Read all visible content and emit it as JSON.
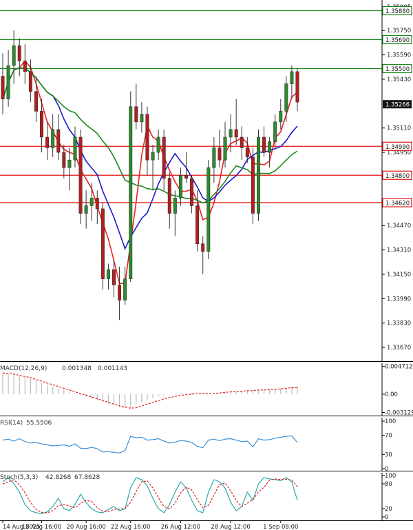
{
  "chart_data": [
    {
      "type": "candlestick",
      "y_ticks": [
        "1.35905",
        "1.35750",
        "1.35590",
        "1.35430",
        "1.35110",
        "1.34950",
        "1.34470",
        "1.34310",
        "1.34150",
        "1.33990",
        "1.33830",
        "1.33670"
      ],
      "y_range": [
        1.3358,
        1.3595
      ],
      "x_ticks": [
        "14 Aug 2025",
        "18 Aug 16:00",
        "20 Aug 16:00",
        "22 Aug 16:00",
        "26 Aug 12:00",
        "28 Aug 12:00",
        "1 Sep 08:00"
      ],
      "current_price": "1.35266",
      "levels": [
        {
          "label": "1.35880",
          "value": 1.3588,
          "color": "#1a8a1a"
        },
        {
          "label": "1.35690",
          "value": 1.3569,
          "color": "#1a8a1a"
        },
        {
          "label": "1.35500",
          "value": 1.355,
          "color": "#1a8a1a"
        },
        {
          "label": "1.34990",
          "value": 1.3499,
          "color": "#e01010"
        },
        {
          "label": "1.34800",
          "value": 1.348,
          "color": "#e01010"
        },
        {
          "label": "1.34620",
          "value": 1.3462,
          "color": "#e01010"
        }
      ],
      "candles": [
        [
          1.3545,
          1.356,
          1.352,
          1.353
        ],
        [
          1.353,
          1.3562,
          1.3525,
          1.3552
        ],
        [
          1.3552,
          1.3575,
          1.354,
          1.3565
        ],
        [
          1.3565,
          1.357,
          1.3545,
          1.3555
        ],
        [
          1.3555,
          1.3566,
          1.354,
          1.3548
        ],
        [
          1.3548,
          1.3556,
          1.3528,
          1.3535
        ],
        [
          1.3535,
          1.3545,
          1.3515,
          1.3522
        ],
        [
          1.3522,
          1.353,
          1.3495,
          1.3505
        ],
        [
          1.3505,
          1.3515,
          1.349,
          1.3498
        ],
        [
          1.3498,
          1.352,
          1.3492,
          1.351
        ],
        [
          1.351,
          1.352,
          1.349,
          1.3495
        ],
        [
          1.3495,
          1.35,
          1.3478,
          1.3485
        ],
        [
          1.3485,
          1.3498,
          1.347,
          1.349
        ],
        [
          1.349,
          1.3512,
          1.3485,
          1.3505
        ],
        [
          1.3505,
          1.351,
          1.3448,
          1.3455
        ],
        [
          1.3455,
          1.347,
          1.3445,
          1.346
        ],
        [
          1.346,
          1.3475,
          1.345,
          1.3465
        ],
        [
          1.3465,
          1.347,
          1.3448,
          1.3458
        ],
        [
          1.3458,
          1.3462,
          1.3405,
          1.3412
        ],
        [
          1.3412,
          1.3422,
          1.3405,
          1.3418
        ],
        [
          1.3418,
          1.3425,
          1.34,
          1.3408
        ],
        [
          1.3408,
          1.342,
          1.3385,
          1.3398
        ],
        [
          1.3398,
          1.342,
          1.3395,
          1.3412
        ],
        [
          1.3412,
          1.3535,
          1.341,
          1.3525
        ],
        [
          1.3525,
          1.354,
          1.351,
          1.3515
        ],
        [
          1.3515,
          1.3528,
          1.3508,
          1.352
        ],
        [
          1.352,
          1.3525,
          1.348,
          1.349
        ],
        [
          1.349,
          1.35,
          1.347,
          1.3495
        ],
        [
          1.3495,
          1.351,
          1.349,
          1.3505
        ],
        [
          1.3505,
          1.351,
          1.347,
          1.3478
        ],
        [
          1.3478,
          1.3482,
          1.3445,
          1.3455
        ],
        [
          1.3455,
          1.347,
          1.344,
          1.3465
        ],
        [
          1.3465,
          1.3485,
          1.346,
          1.348
        ],
        [
          1.348,
          1.3495,
          1.3475,
          1.3478
        ],
        [
          1.3478,
          1.348,
          1.3455,
          1.346
        ],
        [
          1.346,
          1.347,
          1.343,
          1.3435
        ],
        [
          1.3435,
          1.344,
          1.3415,
          1.343
        ],
        [
          1.343,
          1.349,
          1.3425,
          1.3485
        ],
        [
          1.3485,
          1.3505,
          1.3475,
          1.3498
        ],
        [
          1.3498,
          1.351,
          1.3485,
          1.349
        ],
        [
          1.349,
          1.3515,
          1.3485,
          1.3505
        ],
        [
          1.3505,
          1.352,
          1.3495,
          1.351
        ],
        [
          1.351,
          1.353,
          1.35,
          1.3505
        ],
        [
          1.3505,
          1.3512,
          1.349,
          1.3498
        ],
        [
          1.3498,
          1.3505,
          1.3488,
          1.3492
        ],
        [
          1.3492,
          1.3498,
          1.3448,
          1.3455
        ],
        [
          1.3455,
          1.351,
          1.345,
          1.3505
        ],
        [
          1.3505,
          1.3512,
          1.3492,
          1.3495
        ],
        [
          1.3495,
          1.3505,
          1.3485,
          1.3502
        ],
        [
          1.3502,
          1.352,
          1.3498,
          1.3515
        ],
        [
          1.3515,
          1.353,
          1.351,
          1.3522
        ],
        [
          1.3522,
          1.3545,
          1.3515,
          1.354
        ],
        [
          1.354,
          1.3552,
          1.353,
          1.3548
        ],
        [
          1.3548,
          1.355,
          1.3522,
          1.3528
        ]
      ]
    },
    {
      "type": "line",
      "title": "MACD(12,26,9)",
      "values_text": [
        "0.001348",
        "0.001143"
      ],
      "y_ticks": [
        "0.004712",
        "0.00",
        "-0.003129"
      ],
      "y_range": [
        -0.0033,
        0.0048
      ],
      "histogram": [
        0.0035,
        0.0034,
        0.0033,
        0.0031,
        0.0029,
        0.0026,
        0.0023,
        0.0019,
        0.0016,
        0.0013,
        0.001,
        0.0007,
        0.0004,
        0.0002,
        -0.0001,
        -0.0004,
        -0.0007,
        -0.001,
        -0.0013,
        -0.0016,
        -0.0019,
        -0.0022,
        -0.0024,
        -0.0023,
        -0.0018,
        -0.0014,
        -0.001,
        -0.0007,
        -0.0004,
        -0.0002,
        0.0,
        0.0001,
        0.0002,
        0.0002,
        0.0002,
        0.0001,
        0.0,
        0.0,
        0.0001,
        0.0002,
        0.0003,
        0.0004,
        0.0005,
        0.0006,
        0.0007,
        0.0007,
        0.0007,
        0.0008,
        0.0008,
        0.0009,
        0.001,
        0.0011,
        0.0013,
        0.0013
      ],
      "signal": [
        0.0036,
        0.0035,
        0.0034,
        0.0032,
        0.003,
        0.0028,
        0.0025,
        0.0022,
        0.0019,
        0.0016,
        0.0013,
        0.001,
        0.0007,
        0.0004,
        0.0001,
        -0.0002,
        -0.0005,
        -0.0008,
        -0.0011,
        -0.0014,
        -0.0017,
        -0.002,
        -0.0022,
        -0.0024,
        -0.0023,
        -0.002,
        -0.0017,
        -0.0014,
        -0.0011,
        -0.0008,
        -0.0006,
        -0.0004,
        -0.0002,
        -0.0001,
        0.0,
        0.0001,
        0.0001,
        0.0001,
        0.0001,
        0.0002,
        0.0003,
        0.0004,
        0.0004,
        0.0005,
        0.0006,
        0.0006,
        0.0007,
        0.0007,
        0.0008,
        0.0008,
        0.0009,
        0.001,
        0.0011,
        0.0011
      ]
    },
    {
      "type": "line",
      "title": "RSI(14)",
      "value_text": "55.5506",
      "y_ticks": [
        "100",
        "70",
        "30",
        "0"
      ],
      "y_range": [
        0,
        100
      ],
      "values": [
        60,
        62,
        58,
        63,
        57,
        54,
        55,
        52,
        50,
        48,
        49,
        50,
        47,
        52,
        43,
        42,
        45,
        42,
        35,
        36,
        34,
        33,
        38,
        68,
        65,
        66,
        60,
        61,
        63,
        58,
        54,
        56,
        59,
        58,
        55,
        47,
        44,
        60,
        62,
        59,
        62,
        63,
        60,
        57,
        58,
        46,
        63,
        60,
        61,
        64,
        66,
        68,
        69,
        55
      ]
    },
    {
      "type": "line",
      "title": "Stoch(5,3,3)",
      "values_text": [
        "42.8268",
        "67.8628"
      ],
      "y_ticks": [
        "100",
        "80",
        "20",
        "0"
      ],
      "y_range": [
        0,
        100
      ],
      "k": [
        85,
        95,
        80,
        60,
        30,
        15,
        10,
        8,
        12,
        25,
        45,
        20,
        15,
        30,
        55,
        35,
        20,
        12,
        10,
        18,
        25,
        15,
        20,
        70,
        95,
        90,
        75,
        45,
        20,
        10,
        30,
        60,
        85,
        70,
        40,
        15,
        10,
        60,
        90,
        85,
        70,
        35,
        15,
        25,
        60,
        40,
        80,
        95,
        92,
        90,
        88,
        95,
        85,
        40
      ],
      "d": [
        80,
        85,
        90,
        78,
        58,
        35,
        18,
        11,
        10,
        15,
        27,
        30,
        27,
        22,
        33,
        40,
        37,
        22,
        14,
        13,
        18,
        19,
        20,
        35,
        62,
        85,
        87,
        70,
        47,
        25,
        20,
        33,
        58,
        72,
        65,
        42,
        22,
        28,
        53,
        78,
        82,
        63,
        40,
        25,
        33,
        42,
        60,
        72,
        89,
        92,
        90,
        91,
        89,
        73
      ]
    }
  ],
  "colors": {
    "up_candle": "#2e8b2e",
    "down_candle": "#b02020",
    "ma_fast": "#e82020",
    "ma_mid": "#1818d0",
    "ma_slow": "#1a8a1a",
    "osc_line": "#3a8fd8",
    "stoch_k": "#2aa8a8",
    "stoch_d": "#e02020",
    "price_tag_bg": "#111111"
  }
}
